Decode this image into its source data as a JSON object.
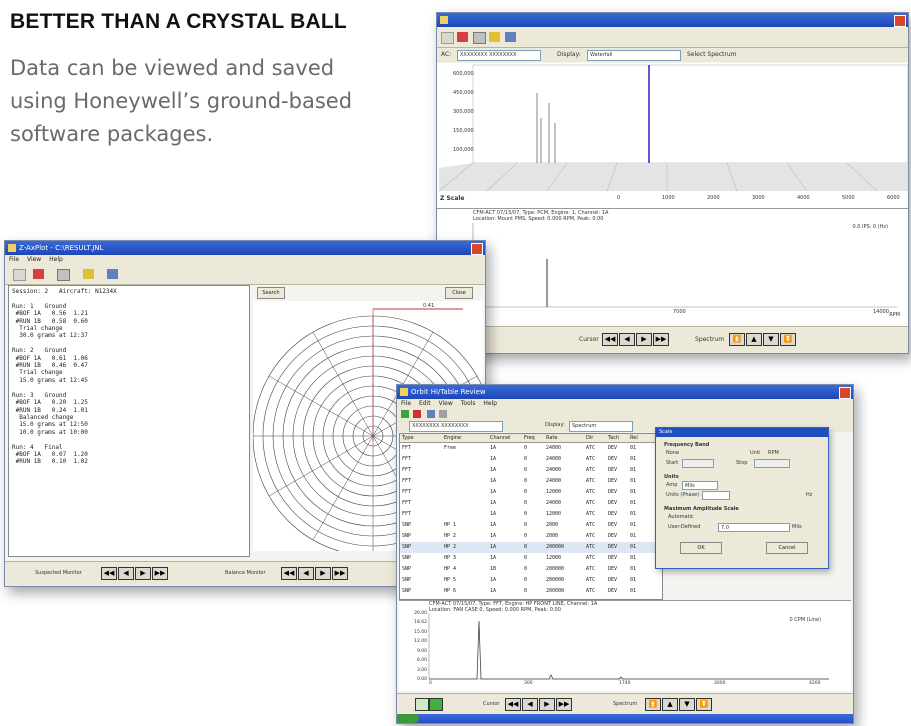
{
  "headline": "BETTER THAN A CRYSTAL BALL",
  "blurb": "Data can be viewed and saved using Honeywell’s ground-based software packages.",
  "colors": {
    "title_bar": "#2050c0",
    "accent_line": "#6655cc",
    "spectrum_line": "#333333"
  },
  "spectrum_window": {
    "ac_label": "AC:",
    "display_label": "Display:",
    "display_value": "Waterfall",
    "select_spectrum_label": "Select Spectrum",
    "y_axis_labels": [
      "600,000",
      "450,000",
      "300,000",
      "150,000",
      "100,000"
    ],
    "z_scale_label": "Z Scale",
    "x_axis_labels": [
      "0",
      "1000",
      "2000",
      "3000",
      "4000",
      "5000",
      "6000"
    ],
    "rpm_tag": "RPM",
    "readout_line1": "CFM-ACT 07/15/07, Type: PCM, Engine: 1, Channel: 1A",
    "readout_line2": "Location: Mount PMS, Speed: 0.000 RPM, Peak: 0.00",
    "readout_ips": "0.0 IPS: 0 (Hz)",
    "lower_x_labels": [
      "0",
      "7000",
      "14000"
    ],
    "cursor_label": "Cursor",
    "spectrum_label": "Spectrum",
    "nav_buttons": [
      "◀◀",
      "◀",
      "▶",
      "▶▶"
    ],
    "spectrum_buttons": [
      "⏫",
      "▲",
      "▼",
      "⏬"
    ]
  },
  "balance_window": {
    "title": "Z-AxPlot - C:\\RESULT.JNL",
    "menu": [
      "File",
      "View",
      "Help"
    ],
    "session_lines": [
      "Session: 2   Aircraft: N1234X",
      "",
      "Run: 1   Ground",
      " #BOF 1A   0.56  1.21",
      " #RUN 1B   0.58  0.60",
      "  Trial change",
      "  30.0 grams at 12:37",
      "",
      "Run: 2   Ground",
      " #BOF 1A   0.61  1.06",
      " #RUN 1B   0.46  0.47",
      "  Trial change",
      "  15.0 grams at 12:45",
      "",
      "Run: 3   Ground",
      " #BOF 1A   0.20  1.25",
      " #RUN 1B   0.24  1.01",
      "  Balanced change",
      "  15.0 grams at 12:50",
      "  10.0 grams at 10:00",
      "",
      "Run: 4   Final",
      " #BOF 1A   0.07  1.20",
      " #RUN 1B   0.10  1.02"
    ],
    "search_btn": "Search",
    "close_btn": "Close",
    "polar_label_top": "0.41",
    "suspected_label": "Suspected Monitor",
    "balance_label": "Balance Monitor",
    "nav_buttons": [
      "◀◀",
      "◀",
      "▶",
      "▶▶"
    ]
  },
  "table_window": {
    "title": "Orbit Hi/Table Review",
    "menu": [
      "File",
      "Edit",
      "View",
      "Tools",
      "Help"
    ],
    "ac_value": "XXXXXXXX XXXXXXXX",
    "display_label": "Display:",
    "display_value": "Spectrum",
    "columns": [
      "Type",
      "Engine",
      "Channel",
      "Freq",
      "Rate",
      "Dir",
      "Tach",
      "Rel"
    ],
    "rows": [
      [
        "FFT",
        "Free",
        "1A",
        "0",
        "24000",
        "ATC",
        "DEV",
        "01"
      ],
      [
        "FFT",
        "",
        "1A",
        "0",
        "24000",
        "ATC",
        "DEV",
        "01"
      ],
      [
        "FFT",
        "",
        "1A",
        "0",
        "24000",
        "ATC",
        "DEV",
        "01"
      ],
      [
        "FFT",
        "",
        "1A",
        "0",
        "24000",
        "ATC",
        "DEV",
        "01"
      ],
      [
        "FFT",
        "",
        "1A",
        "0",
        "12000",
        "ATC",
        "DEV",
        "01"
      ],
      [
        "FFT",
        "",
        "1A",
        "0",
        "24000",
        "ATC",
        "DEV",
        "01"
      ],
      [
        "FFT",
        "",
        "1A",
        "0",
        "12000",
        "ATC",
        "DEV",
        "01"
      ],
      [
        "SNP",
        "HP 1",
        "1A",
        "0",
        "2000",
        "ATC",
        "DEV",
        "01"
      ],
      [
        "SNP",
        "HP 2",
        "1A",
        "0",
        "2000",
        "ATC",
        "DEV",
        "01"
      ],
      [
        "SNP",
        "HP 2",
        "1A",
        "0",
        "200000",
        "ATC",
        "DEV",
        "01"
      ],
      [
        "SNP",
        "HP 3",
        "1A",
        "0",
        "12000",
        "ATC",
        "DEV",
        "01"
      ],
      [
        "SNP",
        "HP 4",
        "1B",
        "0",
        "200000",
        "ATC",
        "DEV",
        "01"
      ],
      [
        "SNP",
        "HP 5",
        "1A",
        "0",
        "200000",
        "ATC",
        "DEV",
        "01"
      ],
      [
        "SNP",
        "HP 6",
        "1A",
        "0",
        "200000",
        "ATC",
        "DEV",
        "01"
      ]
    ],
    "dialog": {
      "title": "Scale",
      "frequency_band_label": "Frequency Band",
      "none_option": "None",
      "unit_label": "Unit",
      "unit_value": "RPM",
      "start_label": "Start",
      "stop_label": "Stop",
      "units_label": "Units",
      "amp_label": "Amp",
      "amp_value": "Mils",
      "units_phase_label": "Units (Phase)",
      "hz_label": "Hz",
      "max_amp_label": "Maximum Amplitude Scale",
      "automatic_label": "Automatic",
      "user_defined_label": "User-Defined",
      "user_defined_value": "7.0",
      "mils_label": "Mils",
      "ok_label": "OK",
      "cancel_label": "Cancel"
    },
    "readout_line1": "CFM-ACT 07/15/07, Type: FFT, Engine: HP FRONT LINE, Channel: 1A",
    "readout_line2": "Location: FAN CASE 0, Speed: 0.000 RPM, Peak: 0.00",
    "readout_ips": "0 CPM (Line)",
    "y_axis_labels": [
      "26.00",
      "18.62",
      "15.00",
      "12.00",
      "9.00",
      "6.00",
      "3.00",
      "0.00"
    ],
    "x_axis_labels": [
      "0",
      "300",
      "1740",
      "3000",
      "4200"
    ],
    "cursor_label": "Cursor",
    "spectrum_label": "Spectrum",
    "nav_buttons": [
      "◀◀",
      "◀",
      "▶",
      "▶▶"
    ],
    "spectrum_buttons": [
      "⏫",
      "▲",
      "▼",
      "⏬"
    ]
  }
}
